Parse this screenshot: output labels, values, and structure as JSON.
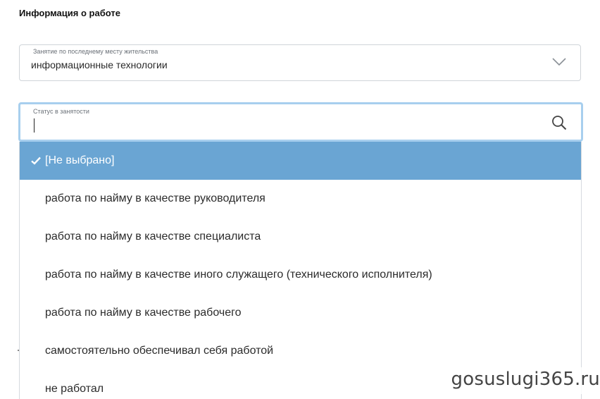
{
  "section": {
    "title": "Информация о работе"
  },
  "occupation_field": {
    "label": "Занятие по последнему месту жительства",
    "value": "информационные технологии",
    "icon": "chevron-down-icon"
  },
  "status_field": {
    "label": "Статус в занятости",
    "value": "",
    "icon": "search-icon"
  },
  "dropdown": {
    "options": [
      {
        "label": "[Не выбрано]",
        "selected": true
      },
      {
        "label": "работа по найму в качестве руководителя",
        "selected": false
      },
      {
        "label": "работа по найму в качестве специалиста",
        "selected": false
      },
      {
        "label": "работа по найму в качестве иного служащего (технического исполнителя)",
        "selected": false
      },
      {
        "label": "работа по найму в качестве рабочего",
        "selected": false
      },
      {
        "label": "самостоятельно обеспечивал себя работой",
        "selected": false
      },
      {
        "label": "не работал",
        "selected": false
      }
    ]
  },
  "watermark": {
    "text": "gosuslugi365.ru"
  },
  "colors": {
    "selected_option_bg": "#6aa5d3",
    "focus_border": "#a8cfee",
    "field_border": "#cfd4d9"
  }
}
